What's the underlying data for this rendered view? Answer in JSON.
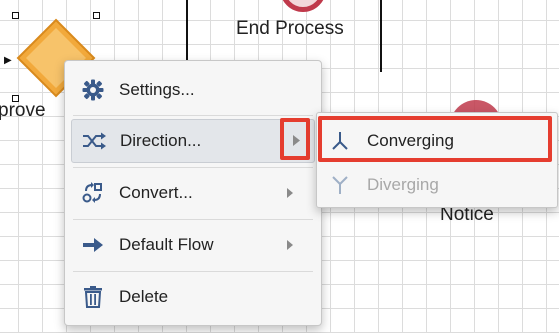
{
  "canvas": {
    "end_process_label": "End Process",
    "approve_label_fragment": "prove",
    "notice_label": "Notice"
  },
  "context_menu": {
    "items": [
      {
        "label": "Settings...",
        "icon": "gear-icon",
        "has_submenu": false
      },
      {
        "label": "Direction...",
        "icon": "shuffle-icon",
        "has_submenu": true,
        "highlighted": true
      },
      {
        "label": "Convert...",
        "icon": "convert-icon",
        "has_submenu": true
      },
      {
        "label": "Default Flow",
        "icon": "arrow-right-icon",
        "has_submenu": true
      },
      {
        "label": "Delete",
        "icon": "trash-icon",
        "has_submenu": false
      }
    ]
  },
  "direction_submenu": {
    "items": [
      {
        "label": "Converging",
        "icon": "converging-icon",
        "enabled": true,
        "highlighted": true
      },
      {
        "label": "Diverging",
        "icon": "diverging-icon",
        "enabled": false
      }
    ]
  },
  "colors": {
    "highlight_box": "#e53d2f",
    "gateway_fill": "#f2a93b",
    "menu_icon": "#3a5a8a"
  }
}
